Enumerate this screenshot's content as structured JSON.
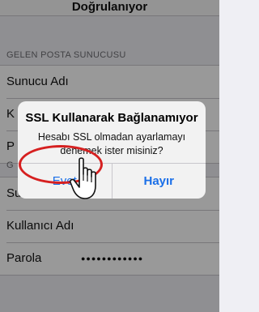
{
  "nav": {
    "title": "Doğrulanıyor"
  },
  "incoming": {
    "header": "GELEN POSTA SUNUCUSU",
    "rows": [
      {
        "label": "Sunucu Adı"
      },
      {
        "label": "K"
      },
      {
        "label": "P"
      }
    ]
  },
  "outgoing": {
    "header": "G",
    "rows": [
      {
        "label": "Sunucu Adı",
        "suffix": "ma"
      },
      {
        "label": "Kullanıcı Adı"
      },
      {
        "label": "Parola",
        "value": "●●●●●●●●●●●●"
      }
    ]
  },
  "alert": {
    "title": "SSL Kullanarak Bağlanamıyor",
    "message_line1": "Hesabı SSL olmadan ayarlamayı",
    "message_line2": "denemek ister misiniz?",
    "yes_label": "Evet",
    "no_label": "Hayır"
  },
  "colors": {
    "accent": "#1a6fe8",
    "highlight": "#d62020"
  },
  "icons": {
    "cursor": "hand-pointer-icon"
  }
}
